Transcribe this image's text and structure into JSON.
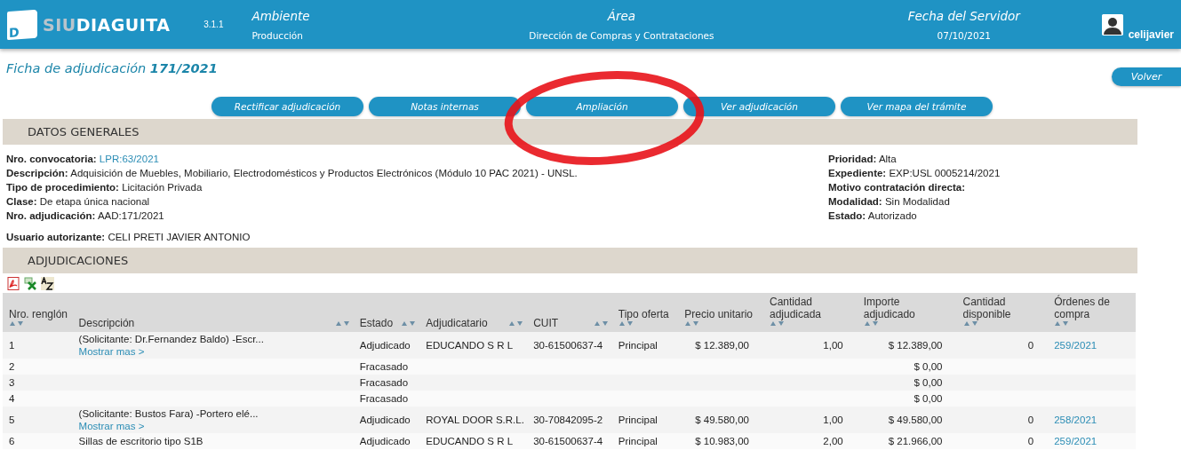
{
  "header": {
    "logo_letter": "D",
    "logo_prefix": "SIU",
    "logo_name": "DIAGUITA",
    "version": "3.1.1",
    "fields": [
      {
        "label": "Ambiente",
        "value": "Producción"
      },
      {
        "label": "Área",
        "value": "Dirección de Compras y Contrataciones"
      },
      {
        "label": "Fecha del Servidor",
        "value": "07/10/2021"
      }
    ],
    "user": "celijavier"
  },
  "title": "Ficha de adjudicación **171/2021**",
  "back_button": "Volver",
  "actions": [
    "Rectificar adjudicación",
    "Notas internas",
    "Ampliación",
    "Ver adjudicación",
    "Ver mapa del trámite"
  ],
  "general": {
    "heading": "DATOS GENERALES",
    "left": [
      {
        "label": "Nro. convocatoria:",
        "value": "LPR:63/2021",
        "kind": "link"
      },
      {
        "label": "Descripción:",
        "value": "Adquisición de Muebles, Mobiliario, Electrodomésticos y Productos Electrónicos (Módulo 10 PAC 2021) - UNSL.",
        "kind": "text"
      },
      {
        "label": "Tipo de procedimiento:",
        "value": "Licitación Privada",
        "kind": "text"
      },
      {
        "label": "Clase:",
        "value": "De etapa única nacional",
        "kind": "text"
      },
      {
        "label": "Nro. adjudicación:",
        "value": "AAD:171/2021",
        "kind": "text"
      }
    ],
    "right": [
      {
        "label": "Prioridad:",
        "value": "Alta",
        "kind": "text"
      },
      {
        "label": "Expediente:",
        "value": "EXP:USL 0005214/2021",
        "kind": "text"
      },
      {
        "label": "Motivo contratación directa:"
      },
      {
        "label": "Modalidad:",
        "value": "Sin Modalidad",
        "kind": "text"
      },
      {
        "label": "Estado:",
        "value": "Autorizado",
        "kind": "text"
      }
    ],
    "authorizer": {
      "label": "Usuario autorizante:",
      "value": "CELI PRETI JAVIER ANTONIO"
    }
  },
  "adjudicaciones": {
    "heading": "ADJUDICACIONES",
    "columns": [
      "Nro. renglón",
      "Descripción",
      "Estado",
      "Adjudicatario",
      "CUIT",
      "Tipo oferta",
      "Precio unitario",
      "Cantidad adjudicada",
      "Importe adjudicado",
      "Cantidad disponible",
      "Órdenes de compra"
    ],
    "rows": [
      {
        "renglon": "1",
        "description": "(Solicitante: Dr.Fernandez Baldo) -Escr...",
        "more_link": "Mostrar mas >",
        "estado": "Adjudicado",
        "adjudicatario": "EDUCANDO S R L",
        "cuit": "30-61500637-4",
        "tipo_oferta": "Principal",
        "precio_unitario": "$ 12.389,00",
        "cantidad_adjudicada": "1,00",
        "importe_adjudicado": "$ 12.389,00",
        "cantidad_disponible": "0",
        "orden_compra": "259/2021"
      },
      {
        "renglon": "2",
        "estado": "Fracasado",
        "importe_adjudicado": "$ 0,00"
      },
      {
        "renglon": "3",
        "estado": "Fracasado",
        "importe_adjudicado": "$ 0,00"
      },
      {
        "renglon": "4",
        "estado": "Fracasado",
        "importe_adjudicado": "$ 0,00"
      },
      {
        "renglon": "5",
        "description": "(Solicitante: Bustos Fara) -Portero elé...",
        "more_link": "Mostrar mas >",
        "estado": "Adjudicado",
        "adjudicatario": "ROYAL DOOR S.R.L.",
        "cuit": "30-70842095-2",
        "tipo_oferta": "Principal",
        "precio_unitario": "$ 49.580,00",
        "cantidad_adjudicada": "1,00",
        "importe_adjudicado": "$ 49.580,00",
        "cantidad_disponible": "0",
        "orden_compra": "258/2021"
      },
      {
        "renglon": "6",
        "description": "Sillas de escritorio tipo S1B",
        "estado": "Adjudicado",
        "adjudicatario": "EDUCANDO S R L",
        "cuit": "30-61500637-4",
        "tipo_oferta": "Principal",
        "precio_unitario": "$ 10.983,00",
        "cantidad_adjudicada": "2,00",
        "importe_adjudicado": "$ 21.966,00",
        "cantidad_disponible": "0",
        "orden_compra": "259/2021"
      }
    ]
  }
}
